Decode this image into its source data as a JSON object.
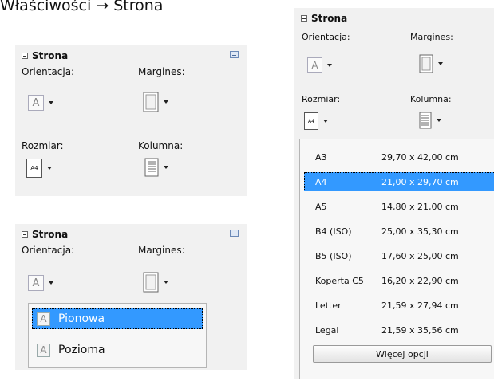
{
  "caption": "Właściwości → Strona",
  "panel": {
    "title": "Strona",
    "orientation_label": "Orientacja:",
    "margins_label": "Margines:",
    "size_label": "Rozmiar:",
    "column_label": "Kolumna:",
    "size_icon_text": "A4",
    "orientation_icon_text": "A"
  },
  "orientation_options": [
    {
      "label": "Pionowa",
      "selected": true
    },
    {
      "label": "Pozioma",
      "selected": false
    }
  ],
  "paper_sizes": [
    {
      "name": "A3",
      "dims": "29,70 x 42,00 cm",
      "selected": false
    },
    {
      "name": "A4",
      "dims": "21,00 x 29,70 cm",
      "selected": true
    },
    {
      "name": "A5",
      "dims": "14,80 x 21,00 cm",
      "selected": false
    },
    {
      "name": "B4 (ISO)",
      "dims": "25,00 x 35,30 cm",
      "selected": false
    },
    {
      "name": "B5 (ISO)",
      "dims": "17,60 x 25,00 cm",
      "selected": false
    },
    {
      "name": "Koperta C5",
      "dims": "16,20 x 22,90 cm",
      "selected": false
    },
    {
      "name": "Letter",
      "dims": "21,59 x 27,94 cm",
      "selected": false
    },
    {
      "name": "Legal",
      "dims": "21,59 x 35,56 cm",
      "selected": false
    }
  ],
  "more_options_label": "Więcej opcji",
  "colors": {
    "selection": "#3399ff",
    "panel_bg": "#f1f1f1"
  }
}
